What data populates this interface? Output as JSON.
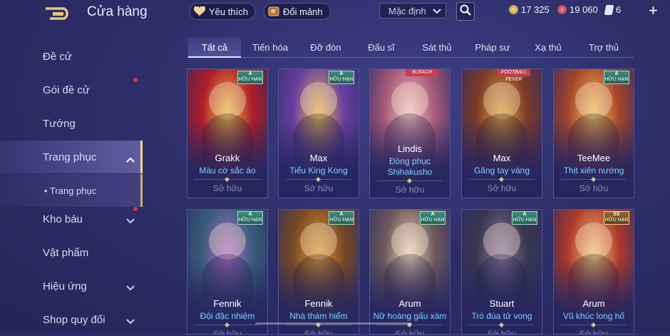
{
  "header": {
    "title": "Cửa hàng",
    "favorites_label": "Yêu thích",
    "fragments_label": "Đổi mảnh",
    "sort_selected": "Mặc định",
    "currencies": [
      {
        "icon": "gold-coin-icon",
        "value": "17 325",
        "color": "#e0b860"
      },
      {
        "icon": "red-gem-icon",
        "value": "19 060",
        "color": "#d34b5f"
      },
      {
        "icon": "voucher-icon",
        "value": "6",
        "color": "#7fb6ff"
      }
    ]
  },
  "sidebar": {
    "items": [
      {
        "label": "Đề cử"
      },
      {
        "label": "Gói đề cử"
      },
      {
        "label": "Tướng"
      },
      {
        "label": "Trang phục"
      },
      {
        "label": "• Trang phục"
      },
      {
        "label": "Kho báu"
      },
      {
        "label": "Vật phẩm"
      },
      {
        "label": "Hiệu ứng"
      },
      {
        "label": "Shop quy đổi"
      }
    ]
  },
  "tabs": [
    "Tất cả",
    "Tiến hóa",
    "Đỡ đòn",
    "Đấu sĩ",
    "Sát thủ",
    "Pháp sư",
    "Xạ thủ",
    "Trợ thủ"
  ],
  "cards": [
    {
      "hero": "Grakk",
      "skin": "Màu cờ sắc áo",
      "status": "Sở hữu",
      "badge_rank": "A",
      "badge_text": "HỮU HẠN",
      "palette": [
        "#b01c28",
        "#e8c04a"
      ]
    },
    {
      "hero": "Max",
      "skin": "Tiểu King Kong",
      "status": "Sở hữu",
      "badge_rank": "A",
      "badge_text": "HỮU HẠN",
      "palette": [
        "#6a3fa0",
        "#e7b84b"
      ]
    },
    {
      "hero": "Lindis",
      "skin": "Đồng phục Shihakusho",
      "status": "Sở hữu",
      "badge_rank": "",
      "badge_text": "",
      "top_logo": "BLEACH",
      "palette": [
        "#a75a78",
        "#f0c3c8"
      ]
    },
    {
      "hero": "Max",
      "skin": "Găng tay vàng",
      "status": "Sở hữu",
      "badge_rank": "",
      "badge_text": "",
      "top_logo": "FOOTBALL FEVER",
      "palette": [
        "#7e3a26",
        "#d9a13e"
      ]
    },
    {
      "hero": "TeeMee",
      "skin": "Thịt xiên nướng",
      "status": "Sở hữu",
      "badge_rank": "A",
      "badge_text": "HỮU HẠN",
      "palette": [
        "#a8452a",
        "#f2c15c"
      ]
    },
    {
      "hero": "Fennik",
      "skin": "Đội đặc nhiệm",
      "status": "Sở hữu",
      "badge_rank": "A",
      "badge_text": "HỮU HẠN",
      "palette": [
        "#3a5d7a",
        "#b36ad1"
      ]
    },
    {
      "hero": "Fennik",
      "skin": "Nhà thám hiểm",
      "status": "Sở hữu",
      "badge_rank": "A",
      "badge_text": "HỮU HẠN",
      "palette": [
        "#7a4a22",
        "#e09a3c"
      ]
    },
    {
      "hero": "Arum",
      "skin": "Nữ hoàng gấu xám",
      "status": "Sở hữu",
      "badge_rank": "A",
      "badge_text": "HỮU HẠN",
      "palette": [
        "#6e5a5a",
        "#f0d2c0"
      ]
    },
    {
      "hero": "Stuart",
      "skin": "Trò đùa tử vong",
      "status": "Sở hữu",
      "badge_rank": "A",
      "badge_text": "HỮU HẠN",
      "palette": [
        "#3a3650",
        "#8a7aa0"
      ]
    },
    {
      "hero": "Arum",
      "skin": "Vũ khúc long hổ",
      "status": "Sở hữu",
      "badge_rank": "SS",
      "badge_text": "HỮU HẠN",
      "palette": [
        "#b03a2a",
        "#f0c87a"
      ]
    }
  ]
}
